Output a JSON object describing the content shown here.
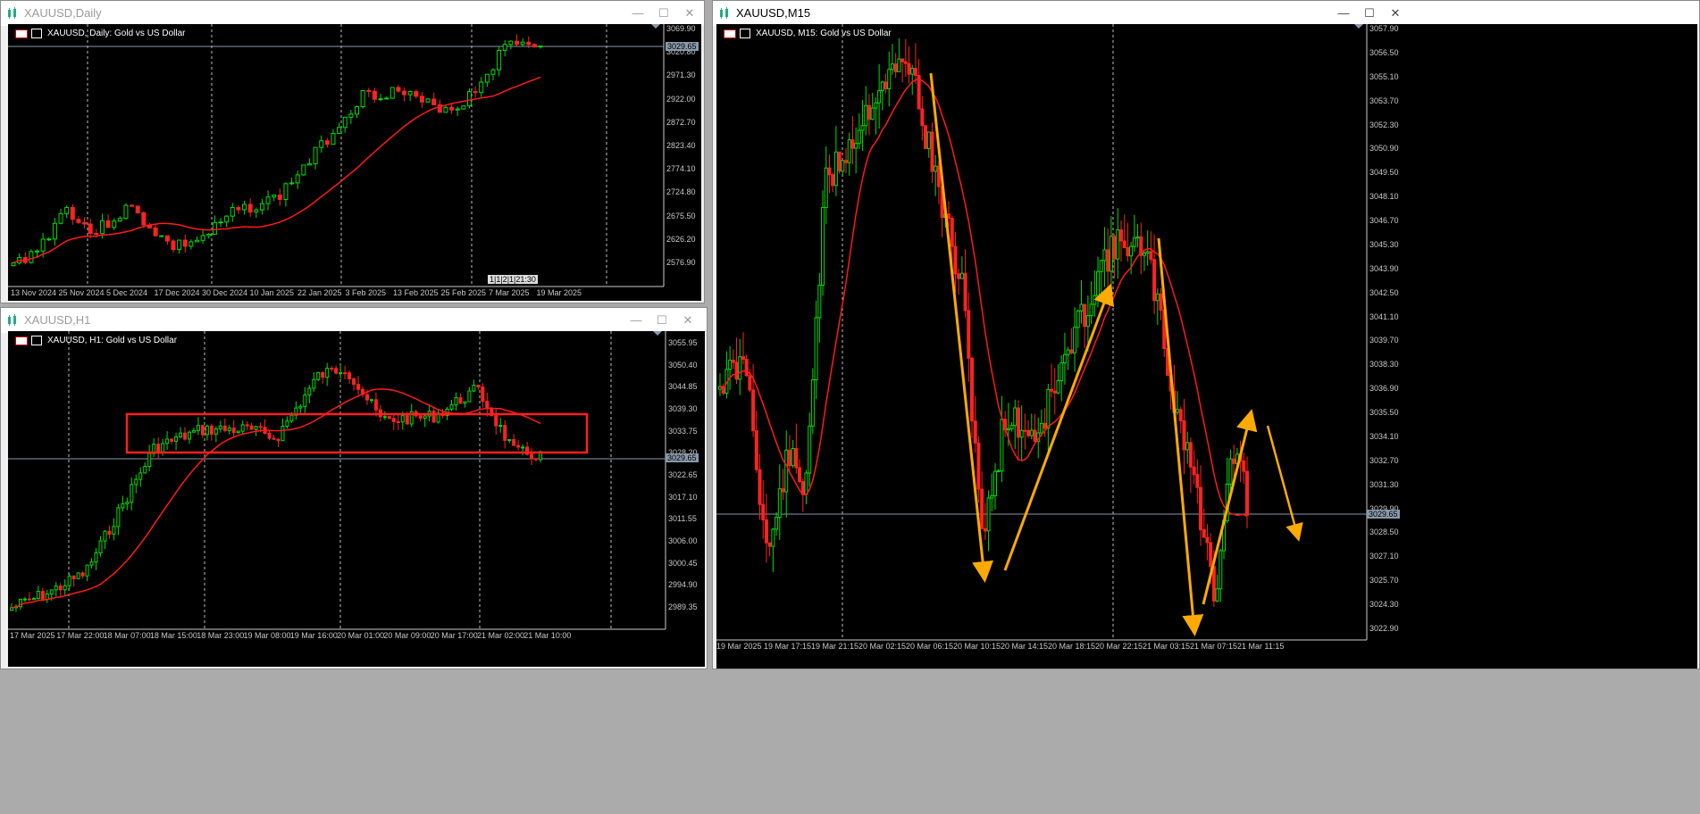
{
  "windows": {
    "daily": {
      "title": "XAUUSD,Daily",
      "label": "XAUUSD, Daily:  Gold vs US Dollar",
      "price_tag": "3029.65",
      "time_tag": "1|1|2|1|21:30",
      "y_labels": [
        "3069.90",
        "3020.80",
        "2971.30",
        "2922.00",
        "2872.70",
        "2823.40",
        "2774.10",
        "2724.80",
        "2675.50",
        "2626.20",
        "2576.90"
      ],
      "x_labels": [
        "13 Nov 2024",
        "25 Nov 2024",
        "5 Dec 2024",
        "17 Dec 2024",
        "30 Dec 2024",
        "10 Jan 2025",
        "22 Jan 2025",
        "3 Feb 2025",
        "13 Feb 2025",
        "25 Feb 2025",
        "7 Mar 2025",
        "19 Mar 2025"
      ]
    },
    "h1": {
      "title": "XAUUSD,H1",
      "label": "XAUUSD, H1:  Gold vs US Dollar",
      "price_tag": "3029.65",
      "y_labels": [
        "3055.95",
        "3050.40",
        "3044.85",
        "3039.30",
        "3033.75",
        "3028.20",
        "3022.65",
        "3017.10",
        "3011.55",
        "3006.00",
        "3000.45",
        "2994.90",
        "2989.35"
      ],
      "x_labels": [
        "17 Mar 2025",
        "17 Mar 22:00",
        "18 Mar 07:00",
        "18 Mar 15:00",
        "18 Mar 23:00",
        "19 Mar 08:00",
        "19 Mar 16:00",
        "20 Mar 01:00",
        "20 Mar 09:00",
        "20 Mar 17:00",
        "21 Mar 02:00",
        "21 Mar 10:00"
      ]
    },
    "m15": {
      "title": "XAUUSD,M15",
      "label": "XAUUSD, M15:  Gold vs US Dollar",
      "price_tag": "3029.65",
      "y_labels": [
        "3057.90",
        "3056.50",
        "3055.10",
        "3053.70",
        "3052.30",
        "3050.90",
        "3049.50",
        "3048.10",
        "3046.70",
        "3045.30",
        "3043.90",
        "3042.50",
        "3041.10",
        "3039.70",
        "3038.30",
        "3036.90",
        "3035.50",
        "3034.10",
        "3032.70",
        "3031.30",
        "3029.90",
        "3028.50",
        "3027.10",
        "3025.70",
        "3024.30",
        "3022.90"
      ],
      "x_labels": [
        "19 Mar 2025",
        "19 Mar 17:15",
        "19 Mar 21:15",
        "20 Mar 02:15",
        "20 Mar 06:15",
        "20 Mar 10:15",
        "20 Mar 14:15",
        "20 Mar 18:15",
        "20 Mar 22:15",
        "21 Mar 03:15",
        "21 Mar 07:15",
        "21 Mar 11:15"
      ]
    }
  },
  "buttons": {
    "minimize": "—",
    "maximize": "☐",
    "close": "✕"
  },
  "colors": {
    "bull": "#00dd00",
    "bear": "#ff2222",
    "ma": "#ff1a1a",
    "grid": "#bbbbbb",
    "arrow": "#ffaa00",
    "rect": "#ff2020"
  },
  "icons": [
    "chart-window-icon",
    "flag-icon",
    "candle-icon",
    "minimize-icon",
    "maximize-icon",
    "close-icon"
  ]
}
